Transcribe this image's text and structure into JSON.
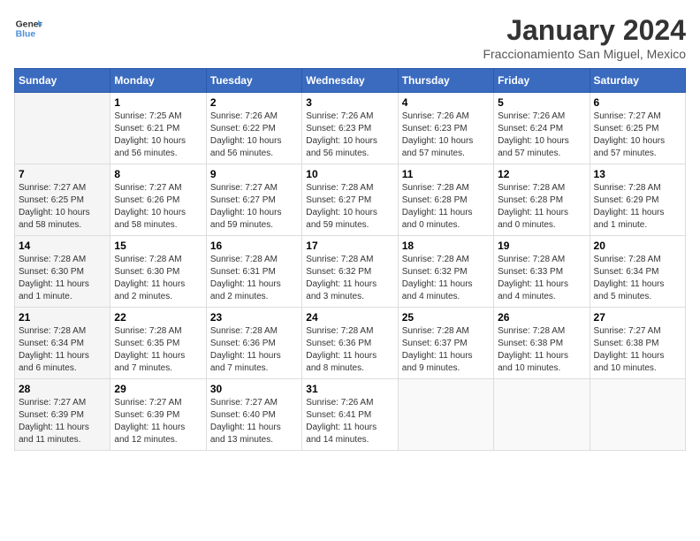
{
  "logo": {
    "text_general": "General",
    "text_blue": "Blue"
  },
  "title": "January 2024",
  "subtitle": "Fraccionamiento San Miguel, Mexico",
  "days_of_week": [
    "Sunday",
    "Monday",
    "Tuesday",
    "Wednesday",
    "Thursday",
    "Friday",
    "Saturday"
  ],
  "weeks": [
    [
      {
        "day": "",
        "detail": ""
      },
      {
        "day": "1",
        "detail": "Sunrise: 7:25 AM\nSunset: 6:21 PM\nDaylight: 10 hours\nand 56 minutes."
      },
      {
        "day": "2",
        "detail": "Sunrise: 7:26 AM\nSunset: 6:22 PM\nDaylight: 10 hours\nand 56 minutes."
      },
      {
        "day": "3",
        "detail": "Sunrise: 7:26 AM\nSunset: 6:23 PM\nDaylight: 10 hours\nand 56 minutes."
      },
      {
        "day": "4",
        "detail": "Sunrise: 7:26 AM\nSunset: 6:23 PM\nDaylight: 10 hours\nand 57 minutes."
      },
      {
        "day": "5",
        "detail": "Sunrise: 7:26 AM\nSunset: 6:24 PM\nDaylight: 10 hours\nand 57 minutes."
      },
      {
        "day": "6",
        "detail": "Sunrise: 7:27 AM\nSunset: 6:25 PM\nDaylight: 10 hours\nand 57 minutes."
      }
    ],
    [
      {
        "day": "7",
        "detail": "Sunrise: 7:27 AM\nSunset: 6:25 PM\nDaylight: 10 hours\nand 58 minutes."
      },
      {
        "day": "8",
        "detail": "Sunrise: 7:27 AM\nSunset: 6:26 PM\nDaylight: 10 hours\nand 58 minutes."
      },
      {
        "day": "9",
        "detail": "Sunrise: 7:27 AM\nSunset: 6:27 PM\nDaylight: 10 hours\nand 59 minutes."
      },
      {
        "day": "10",
        "detail": "Sunrise: 7:28 AM\nSunset: 6:27 PM\nDaylight: 10 hours\nand 59 minutes."
      },
      {
        "day": "11",
        "detail": "Sunrise: 7:28 AM\nSunset: 6:28 PM\nDaylight: 11 hours\nand 0 minutes."
      },
      {
        "day": "12",
        "detail": "Sunrise: 7:28 AM\nSunset: 6:28 PM\nDaylight: 11 hours\nand 0 minutes."
      },
      {
        "day": "13",
        "detail": "Sunrise: 7:28 AM\nSunset: 6:29 PM\nDaylight: 11 hours\nand 1 minute."
      }
    ],
    [
      {
        "day": "14",
        "detail": "Sunrise: 7:28 AM\nSunset: 6:30 PM\nDaylight: 11 hours\nand 1 minute."
      },
      {
        "day": "15",
        "detail": "Sunrise: 7:28 AM\nSunset: 6:30 PM\nDaylight: 11 hours\nand 2 minutes."
      },
      {
        "day": "16",
        "detail": "Sunrise: 7:28 AM\nSunset: 6:31 PM\nDaylight: 11 hours\nand 2 minutes."
      },
      {
        "day": "17",
        "detail": "Sunrise: 7:28 AM\nSunset: 6:32 PM\nDaylight: 11 hours\nand 3 minutes."
      },
      {
        "day": "18",
        "detail": "Sunrise: 7:28 AM\nSunset: 6:32 PM\nDaylight: 11 hours\nand 4 minutes."
      },
      {
        "day": "19",
        "detail": "Sunrise: 7:28 AM\nSunset: 6:33 PM\nDaylight: 11 hours\nand 4 minutes."
      },
      {
        "day": "20",
        "detail": "Sunrise: 7:28 AM\nSunset: 6:34 PM\nDaylight: 11 hours\nand 5 minutes."
      }
    ],
    [
      {
        "day": "21",
        "detail": "Sunrise: 7:28 AM\nSunset: 6:34 PM\nDaylight: 11 hours\nand 6 minutes."
      },
      {
        "day": "22",
        "detail": "Sunrise: 7:28 AM\nSunset: 6:35 PM\nDaylight: 11 hours\nand 7 minutes."
      },
      {
        "day": "23",
        "detail": "Sunrise: 7:28 AM\nSunset: 6:36 PM\nDaylight: 11 hours\nand 7 minutes."
      },
      {
        "day": "24",
        "detail": "Sunrise: 7:28 AM\nSunset: 6:36 PM\nDaylight: 11 hours\nand 8 minutes."
      },
      {
        "day": "25",
        "detail": "Sunrise: 7:28 AM\nSunset: 6:37 PM\nDaylight: 11 hours\nand 9 minutes."
      },
      {
        "day": "26",
        "detail": "Sunrise: 7:28 AM\nSunset: 6:38 PM\nDaylight: 11 hours\nand 10 minutes."
      },
      {
        "day": "27",
        "detail": "Sunrise: 7:27 AM\nSunset: 6:38 PM\nDaylight: 11 hours\nand 10 minutes."
      }
    ],
    [
      {
        "day": "28",
        "detail": "Sunrise: 7:27 AM\nSunset: 6:39 PM\nDaylight: 11 hours\nand 11 minutes."
      },
      {
        "day": "29",
        "detail": "Sunrise: 7:27 AM\nSunset: 6:39 PM\nDaylight: 11 hours\nand 12 minutes."
      },
      {
        "day": "30",
        "detail": "Sunrise: 7:27 AM\nSunset: 6:40 PM\nDaylight: 11 hours\nand 13 minutes."
      },
      {
        "day": "31",
        "detail": "Sunrise: 7:26 AM\nSunset: 6:41 PM\nDaylight: 11 hours\nand 14 minutes."
      },
      {
        "day": "",
        "detail": ""
      },
      {
        "day": "",
        "detail": ""
      },
      {
        "day": "",
        "detail": ""
      }
    ]
  ]
}
